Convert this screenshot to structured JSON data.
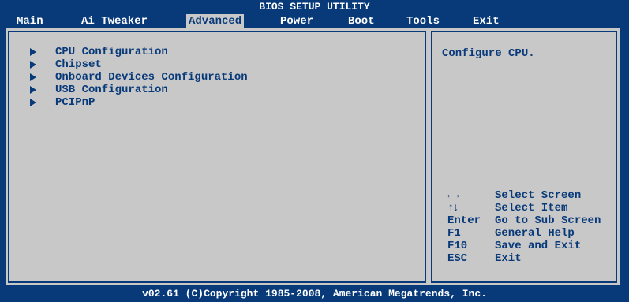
{
  "title": "BIOS SETUP UTILITY",
  "menu": [
    {
      "label": "Main"
    },
    {
      "label": "Ai Tweaker"
    },
    {
      "label": "Advanced",
      "selected": true
    },
    {
      "label": "Power"
    },
    {
      "label": "Boot"
    },
    {
      "label": "Tools"
    },
    {
      "label": "Exit"
    }
  ],
  "entries": [
    {
      "label": "CPU Configuration"
    },
    {
      "label": "Chipset"
    },
    {
      "label": "Onboard Devices Configuration"
    },
    {
      "label": "USB Configuration"
    },
    {
      "label": "PCIPnP"
    }
  ],
  "help": "Configure CPU.",
  "keys": [
    {
      "key": "←→",
      "desc": "Select Screen",
      "icon": "left-right-arrows-icon"
    },
    {
      "key": "↑↓",
      "desc": "Select Item",
      "icon": "up-down-arrows-icon"
    },
    {
      "key": "Enter",
      "desc": "Go to Sub Screen"
    },
    {
      "key": "F1",
      "desc": "General Help"
    },
    {
      "key": "F10",
      "desc": "Save and Exit"
    },
    {
      "key": "ESC",
      "desc": "Exit"
    }
  ],
  "footer": "v02.61 (C)Copyright 1985-2008, American Megatrends, Inc.",
  "colors": {
    "background": "#083a7a",
    "panel": "#c8c8c8",
    "text": "#083a7a",
    "header_text": "#ffffff"
  }
}
